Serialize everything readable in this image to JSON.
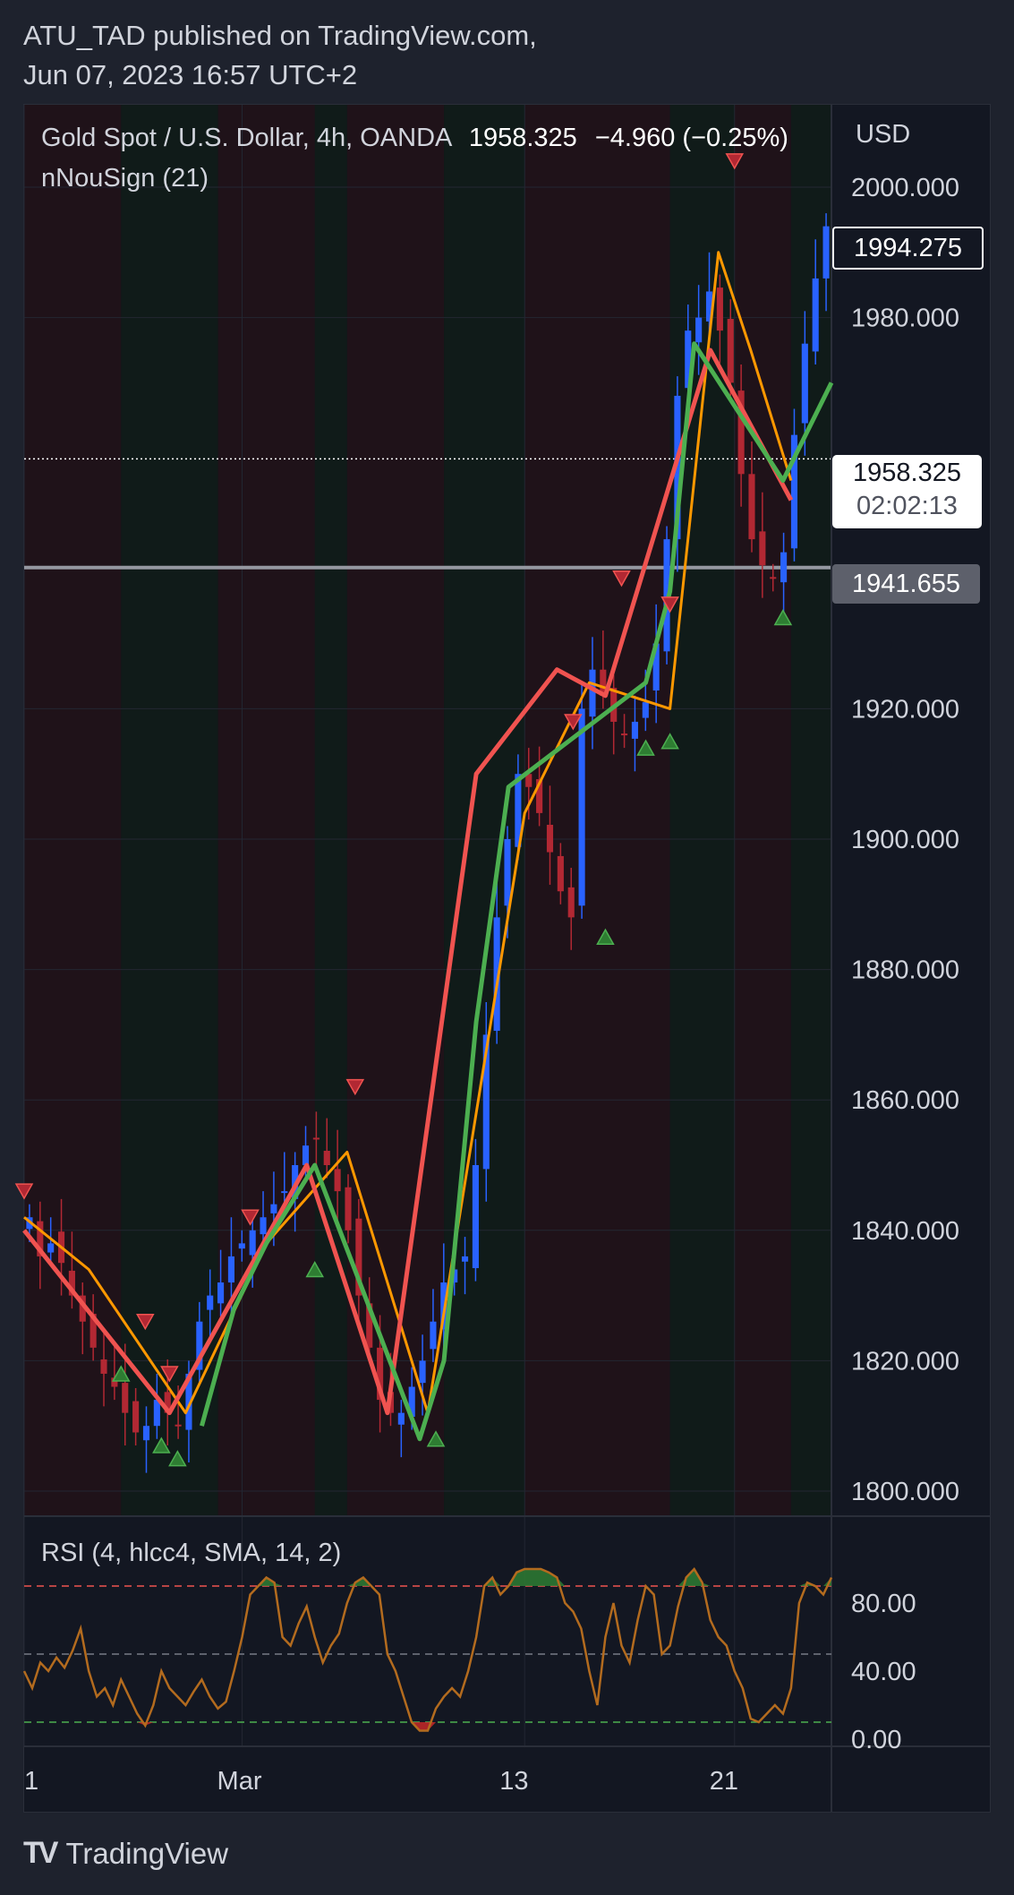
{
  "header": {
    "line1": "ATU_TAD published on TradingView.com,",
    "line2": "Jun 07, 2023 16:57 UTC+2"
  },
  "legend": {
    "symbol": "Gold Spot / U.S. Dollar, 4h, OANDA",
    "price": "1958.325",
    "change": "−4.960 (−0.25%)",
    "indicator": "nNouSign (21)",
    "currency": "USD",
    "rsi_label": "RSI (4, hlcc4, SMA, 14, 2)"
  },
  "price_badges": {
    "top": "1994.275",
    "current": "1958.325",
    "countdown": "02:02:13",
    "line": "1941.655"
  },
  "footer": {
    "brand": "TradingView"
  },
  "colors": {
    "up": "#2962ff",
    "down": "#b22833",
    "green_line": "#4caf50",
    "red_line": "#f05350",
    "orange_line": "#ff9800",
    "rsi": "#b36b1e"
  },
  "chart_data": [
    {
      "type": "candlestick",
      "title": "Gold Spot / U.S. Dollar, 4h, OANDA",
      "ylim": [
        1800,
        2000
      ],
      "y_ticks": [
        "2000.000",
        "1980.000",
        "1920.000",
        "1900.000",
        "1880.000",
        "1860.000",
        "1840.000",
        "1820.000",
        "1800.000"
      ],
      "x_ticks": [
        "1",
        "Mar",
        "13",
        "21"
      ],
      "close_path": [
        1842,
        1836,
        1838,
        1835,
        1830,
        1826,
        1822,
        1818,
        1816,
        1812,
        1809,
        1810,
        1814,
        1812,
        1810,
        1818,
        1826,
        1830,
        1832,
        1836,
        1838,
        1840,
        1842,
        1844,
        1846,
        1850,
        1853,
        1854,
        1850,
        1846,
        1840,
        1830,
        1822,
        1814,
        1812,
        1812,
        1816,
        1820,
        1826,
        1832,
        1834,
        1836,
        1850,
        1870,
        1888,
        1900,
        1910,
        1908,
        1904,
        1898,
        1892,
        1888,
        1920,
        1926,
        1922,
        1918,
        1916,
        1918,
        1921,
        1930,
        1946,
        1968,
        1978,
        1980,
        1984,
        1978,
        1970,
        1956,
        1946,
        1942,
        1940,
        1944,
        1962,
        1976,
        1986,
        1994
      ],
      "trend_green": [
        [
          0.22,
          1810
        ],
        [
          0.26,
          1828
        ],
        [
          0.3,
          1838
        ],
        [
          0.36,
          1850
        ],
        [
          0.49,
          1808
        ],
        [
          0.52,
          1820
        ],
        [
          0.56,
          1872
        ],
        [
          0.6,
          1908
        ],
        [
          0.77,
          1924
        ],
        [
          0.8,
          1938
        ],
        [
          0.83,
          1976
        ],
        [
          0.94,
          1955
        ],
        [
          1.0,
          1970
        ]
      ],
      "trend_red": [
        [
          0.0,
          1840
        ],
        [
          0.18,
          1812
        ],
        [
          0.35,
          1850
        ],
        [
          0.45,
          1812
        ],
        [
          0.56,
          1910
        ],
        [
          0.66,
          1926
        ],
        [
          0.72,
          1922
        ],
        [
          0.85,
          1975
        ],
        [
          0.95,
          1952
        ]
      ],
      "trend_orange": [
        [
          0.0,
          1842
        ],
        [
          0.08,
          1834
        ],
        [
          0.2,
          1812
        ],
        [
          0.3,
          1838
        ],
        [
          0.4,
          1852
        ],
        [
          0.46,
          1828
        ],
        [
          0.5,
          1812
        ],
        [
          0.62,
          1904
        ],
        [
          0.7,
          1924
        ],
        [
          0.8,
          1920
        ],
        [
          0.86,
          1990
        ],
        [
          0.9,
          1975
        ],
        [
          0.95,
          1955
        ]
      ],
      "signals_down": [
        [
          0.0,
          1846
        ],
        [
          0.15,
          1826
        ],
        [
          0.18,
          1818
        ],
        [
          0.28,
          1842
        ],
        [
          0.41,
          1862
        ],
        [
          0.68,
          1918
        ],
        [
          0.74,
          1940
        ],
        [
          0.8,
          1936
        ],
        [
          0.88,
          2004
        ]
      ],
      "signals_up": [
        [
          0.12,
          1818
        ],
        [
          0.17,
          1807
        ],
        [
          0.19,
          1805
        ],
        [
          0.36,
          1834
        ],
        [
          0.51,
          1808
        ],
        [
          0.72,
          1885
        ],
        [
          0.77,
          1914
        ],
        [
          0.8,
          1915
        ],
        [
          0.94,
          1934
        ]
      ]
    },
    {
      "type": "line",
      "title": "RSI (4, hlcc4, SMA, 14, 2)",
      "ylim": [
        0,
        100
      ],
      "y_ticks": [
        "80.00",
        "40.00",
        "0.00"
      ],
      "levels": [
        90,
        50,
        10
      ],
      "values": [
        40,
        30,
        45,
        40,
        48,
        42,
        52,
        65,
        40,
        25,
        30,
        20,
        35,
        25,
        15,
        8,
        20,
        40,
        30,
        25,
        20,
        28,
        35,
        25,
        18,
        22,
        40,
        60,
        85,
        90,
        95,
        92,
        60,
        55,
        68,
        78,
        60,
        45,
        55,
        62,
        80,
        92,
        95,
        90,
        85,
        50,
        40,
        25,
        10,
        5,
        5,
        18,
        25,
        30,
        25,
        40,
        60,
        90,
        95,
        85,
        90,
        98,
        100,
        100,
        100,
        98,
        95,
        80,
        75,
        65,
        40,
        20,
        60,
        80,
        55,
        45,
        70,
        90,
        85,
        50,
        55,
        78,
        95,
        100,
        92,
        70,
        60,
        55,
        40,
        30,
        12,
        10,
        15,
        20,
        15,
        30,
        80,
        92,
        90,
        85,
        95
      ]
    }
  ]
}
